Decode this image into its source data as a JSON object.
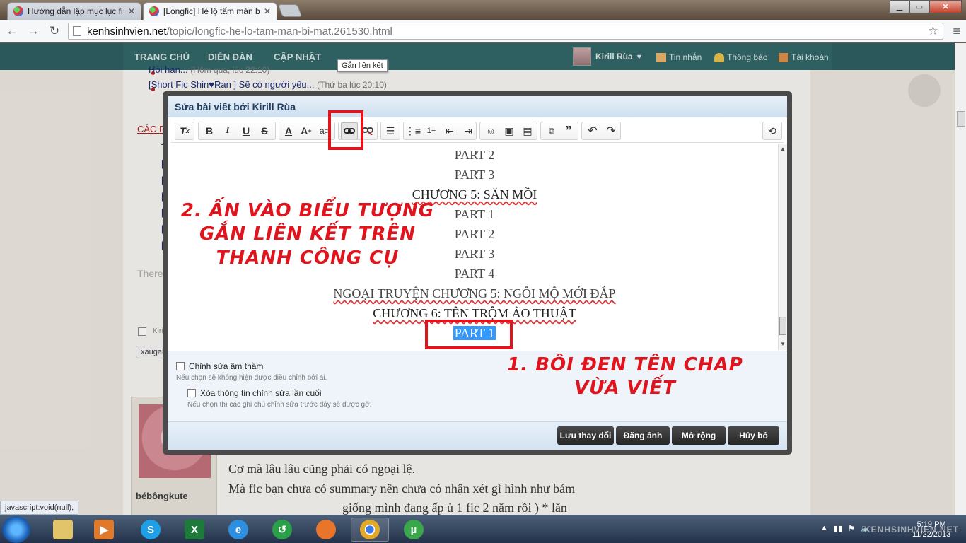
{
  "browser": {
    "tabs": [
      {
        "title": "Hướng dẫn lập mục lục fi"
      },
      {
        "title": "[Longfic] Hé lộ tấm màn b"
      }
    ],
    "url_host": "kenhsinhvien.net",
    "url_path": "/topic/longfic-he-lo-tam-man-bi-mat.261530.html",
    "window_buttons": {
      "minimize": "▁",
      "maximize": "▭",
      "close": "✕"
    }
  },
  "site": {
    "nav": [
      "TRANG CHỦ",
      "DIỄN ĐÀN",
      "CẬP NHẬT"
    ],
    "user": "Kirill Rùa",
    "utils": [
      "Tin nhắn",
      "Thông báo",
      "Tài khoản"
    ],
    "list_items": [
      {
        "text": "Hỏi han...",
        "meta": "(Hôm qua, lúc 22:10)"
      },
      {
        "text": "[Short Fic Shin♥Ran ] Sẽ có người yêu...",
        "meta": "(Thứ ba lúc 20:10)"
      }
    ],
    "red_header": "CÁC BÀ",
    "stub_items": [
      "T",
      "[S",
      "[",
      "[L",
      "[F",
      "[S",
      "[L"
    ],
    "faint_text": "There",
    "checkbox_label": "Kiri",
    "tag_text": "xaugai",
    "poster_name": "bébôngkute",
    "post_lines": [
      "Cơ mà lâu lâu cũng phải có ngoại lệ.",
      "Mà fic bạn chưa có summary nên chưa có nhận xét gì hình như bám",
      "giống mình đang ấp ủ 1 fic 2 năm rồi      ) * lăn"
    ]
  },
  "modal": {
    "title": "Sửa bài viết bởi Kirill Rùa",
    "tooltip": "Gắn liên kết",
    "lines": [
      {
        "text": "PART 2",
        "style": "plain"
      },
      {
        "text": "PART 3",
        "style": "plain"
      },
      {
        "text": "CHƯƠNG 5: SĂN MỒI",
        "style": "bold"
      },
      {
        "text": "PART 1",
        "style": "plain"
      },
      {
        "text": "PART 2",
        "style": "plain"
      },
      {
        "text": "PART 3",
        "style": "plain"
      },
      {
        "text": "PART 4",
        "style": "plain"
      },
      {
        "text": "NGOẠI TRUYỆN CHƯƠNG 5: NGÔI MỘ MỚI ĐẮP",
        "style": "plain"
      },
      {
        "text": "CHƯƠNG 6: TÊN TRỘM ẢO THUẬT",
        "style": "bold"
      },
      {
        "text": "PART 1",
        "style": "selected"
      }
    ],
    "option1_label": "Chỉnh sửa âm thầm",
    "option1_hint": "Nếu chọn sẽ không hiện được điều chỉnh bởi ai.",
    "option2_label": "Xóa thông tin chỉnh sửa lần cuối",
    "option2_hint": "Nếu chọn thì các ghi chú chỉnh sửa trước đây sẽ được gỡ.",
    "buttons": {
      "save": "Lưu thay đổi",
      "upload": "Đăng ảnh",
      "expand": "Mở rộng",
      "cancel": "Hủy bỏ"
    }
  },
  "annotations": {
    "step2": "2. ẤN VÀO BIỂU TƯỢNG\nGẮN LIÊN KẾT TRÊN\nTHANH CÔNG CỤ",
    "step1": "1. BÔI ĐEN TÊN CHAP\nVỪA VIẾT"
  },
  "status_text": "javascript:void(null);",
  "taskbar": {
    "time": "5:19 PM",
    "date": "11/22/2013",
    "watermark": "KENHSINHVIEN.NET"
  },
  "colors": {
    "annotation_red": "#e0141c",
    "nav_teal": "#2f6466",
    "selection_blue": "#3399ff"
  }
}
